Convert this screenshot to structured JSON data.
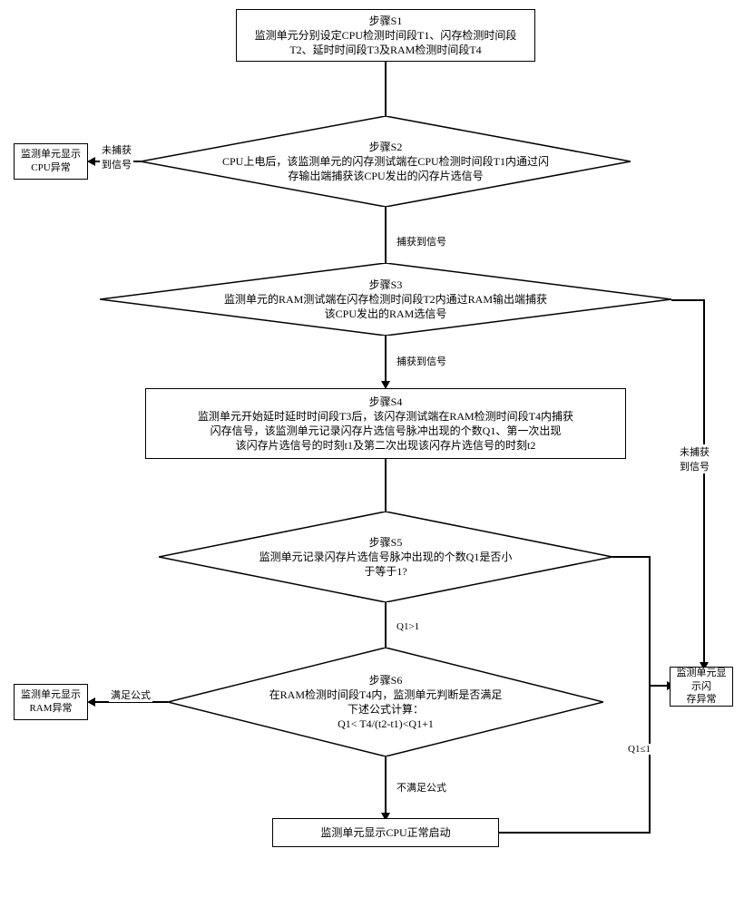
{
  "nodes": {
    "s1": {
      "title": "步骤S1",
      "body": "监测单元分别设定CPU检测时间段T1、闪存检测时间段\nT2、延时时间段T3及RAM检测时间段T4"
    },
    "s2": {
      "title": "步骤S2",
      "body": "CPU上电后，该监测单元的闪存测试端在CPU检测时间段T1内通过闪\n存输出端捕获该CPU发出的闪存片选信号"
    },
    "s3": {
      "title": "步骤S3",
      "body": "监测单元的RAM测试端在闪存检测时间段T2内通过RAM输出端捕获\n该CPU发出的RAM选信号"
    },
    "s4": {
      "title": "步骤S4",
      "body": "监测单元开始延时延时时间段T3后，该闪存测试端在RAM检测时间段T4内捕获\n闪存信号，该监测单元记录闪存片选信号脉冲出现的个数Q1、第一次出现\n该闪存片选信号的时刻t1及第二次出现该闪存片选信号的时刻t2"
    },
    "s5": {
      "title": "步骤S5",
      "body": "监测单元记录闪存片选信号脉冲出现的个数Q1是否小\n于等于1?"
    },
    "s6": {
      "title": "步骤S6",
      "body1": "在RAM检测时间段T4内，监测单元判断是否满足",
      "body2": "下述公式计算：",
      "body3": "Q1< T4/(t2-t1)<Q1+1"
    },
    "cpu_err": "监测单元显示\nCPU异常",
    "ram_err": "监测单元显示\nRAM异常",
    "flash_err": "监测单元显示闪\n存异常",
    "normal": "监测单元显示CPU正常启动"
  },
  "edges": {
    "s2_no": "未捕获\n到信号",
    "s2_yes": "捕获到信号",
    "s3_yes": "捕获到信号",
    "s3_no": "未捕获\n到信号",
    "s5_gt": "Q1>1",
    "s5_le": "Q1≤1",
    "s6_yes": "满足公式",
    "s6_no": "不满足公式"
  }
}
